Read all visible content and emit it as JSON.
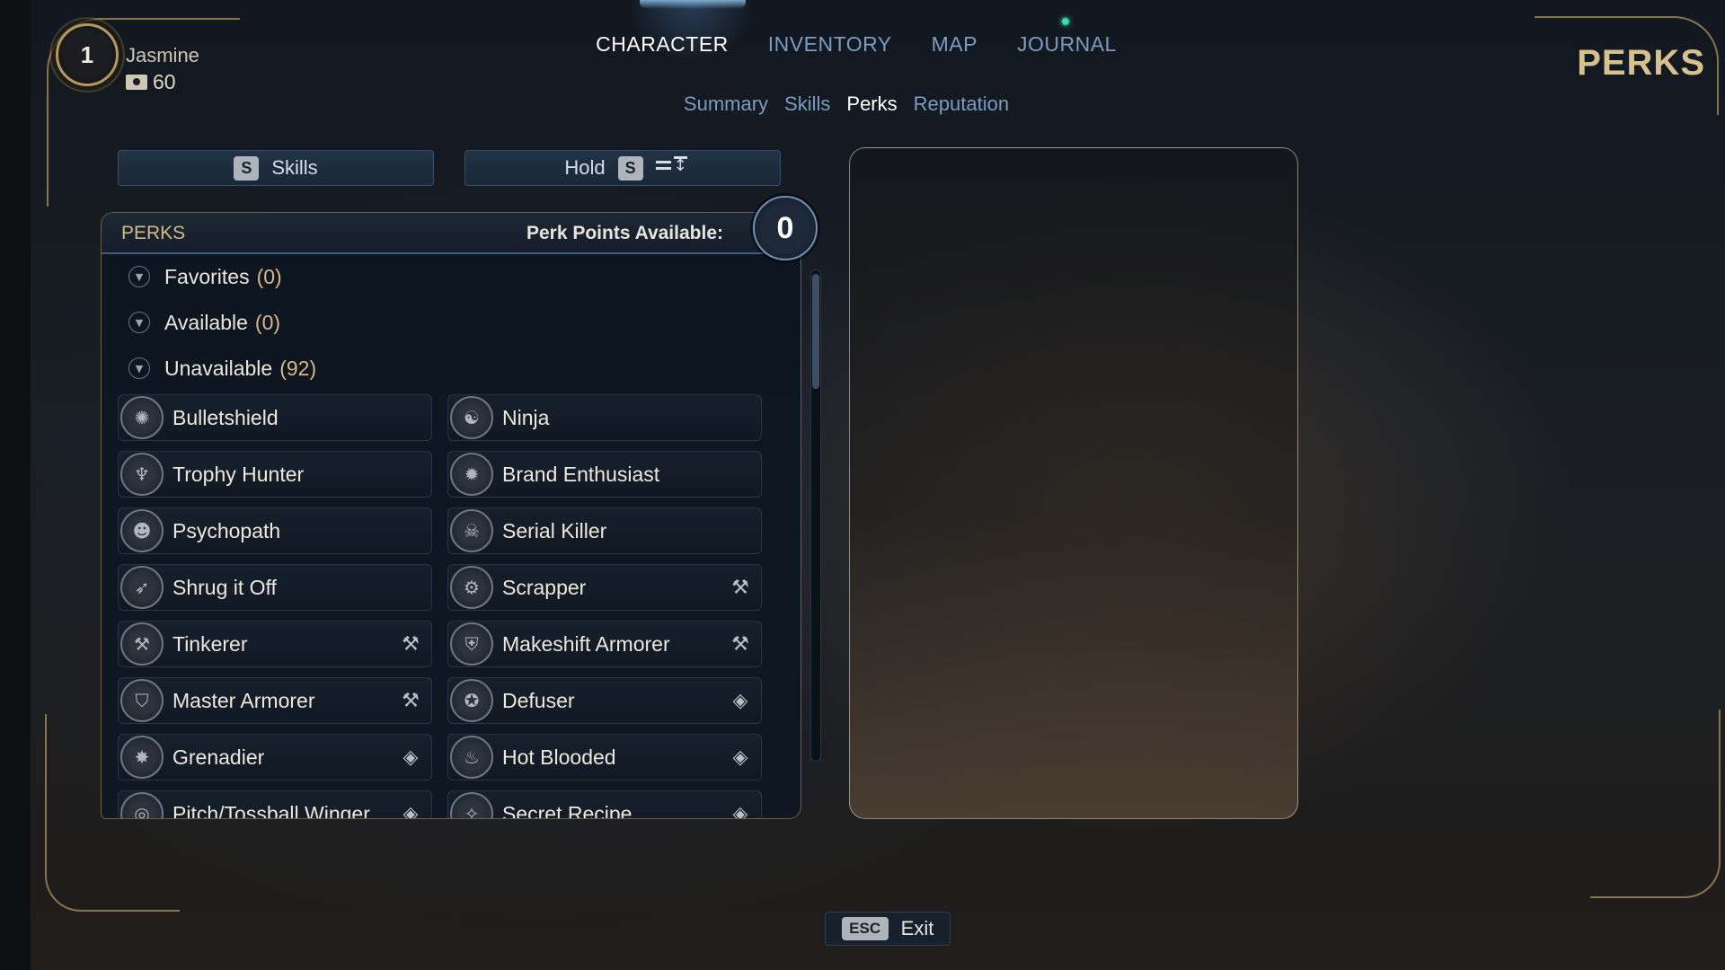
{
  "player": {
    "level": "1",
    "name": "Jasmine",
    "money": "60"
  },
  "main_nav": [
    "CHARACTER",
    "INVENTORY",
    "MAP",
    "JOURNAL"
  ],
  "main_nav_active": "CHARACTER",
  "sub_nav": [
    "Summary",
    "Skills",
    "Perks",
    "Reputation"
  ],
  "sub_nav_active": "Perks",
  "screen_title": "PERKS",
  "actions": {
    "skills_key": "S",
    "skills_label": "Skills",
    "sort_hold_label": "Hold",
    "sort_key": "S"
  },
  "panel": {
    "title": "PERKS",
    "points_label": "Perk Points Available:",
    "points_value": "0"
  },
  "categories": [
    {
      "label": "Favorites",
      "count": "(0)"
    },
    {
      "label": "Available",
      "count": "(0)"
    },
    {
      "label": "Unavailable",
      "count": "(92)"
    }
  ],
  "perks": [
    {
      "name": "Bulletshield",
      "icon": "shield-burst-icon",
      "glyph": "✺",
      "badge": ""
    },
    {
      "name": "Ninja",
      "icon": "ninja-icon",
      "glyph": "☯",
      "badge": ""
    },
    {
      "name": "Trophy Hunter",
      "icon": "trophy-icon",
      "glyph": "♆",
      "badge": ""
    },
    {
      "name": "Brand Enthusiast",
      "icon": "brand-icon",
      "glyph": "✹",
      "badge": ""
    },
    {
      "name": "Psychopath",
      "icon": "psychopath-icon",
      "glyph": "☻",
      "badge": ""
    },
    {
      "name": "Serial Killer",
      "icon": "serial-killer-icon",
      "glyph": "☠",
      "badge": ""
    },
    {
      "name": "Shrug it Off",
      "icon": "shrug-icon",
      "glyph": "➶",
      "badge": ""
    },
    {
      "name": "Scrapper",
      "icon": "scrapper-icon",
      "glyph": "⚙",
      "badge": "wrench-icon"
    },
    {
      "name": "Tinkerer",
      "icon": "tinkerer-icon",
      "glyph": "⚒",
      "badge": "wrench-icon"
    },
    {
      "name": "Makeshift Armorer",
      "icon": "makeshift-armorer-icon",
      "glyph": "⛨",
      "badge": "wrench-icon"
    },
    {
      "name": "Master Armorer",
      "icon": "master-armorer-icon",
      "glyph": "⛉",
      "badge": "wrench-icon"
    },
    {
      "name": "Defuser",
      "icon": "defuser-icon",
      "glyph": "✪",
      "badge": "grenade-icon"
    },
    {
      "name": "Grenadier",
      "icon": "grenadier-icon",
      "glyph": "✸",
      "badge": "grenade-icon"
    },
    {
      "name": "Hot Blooded",
      "icon": "hot-blooded-icon",
      "glyph": "♨",
      "badge": "grenade-icon"
    },
    {
      "name": "Pitch/Tossball Winger",
      "icon": "pitch-icon",
      "glyph": "◎",
      "badge": "grenade-icon"
    },
    {
      "name": "Secret Recipe",
      "icon": "secret-recipe-icon",
      "glyph": "✧",
      "badge": "grenade-icon"
    }
  ],
  "exit": {
    "key": "ESC",
    "label": "Exit"
  },
  "colors": {
    "accent_gold": "#d6b884",
    "nav_inactive": "#7b9cc0",
    "journal_dot": "#3ce0b0"
  }
}
